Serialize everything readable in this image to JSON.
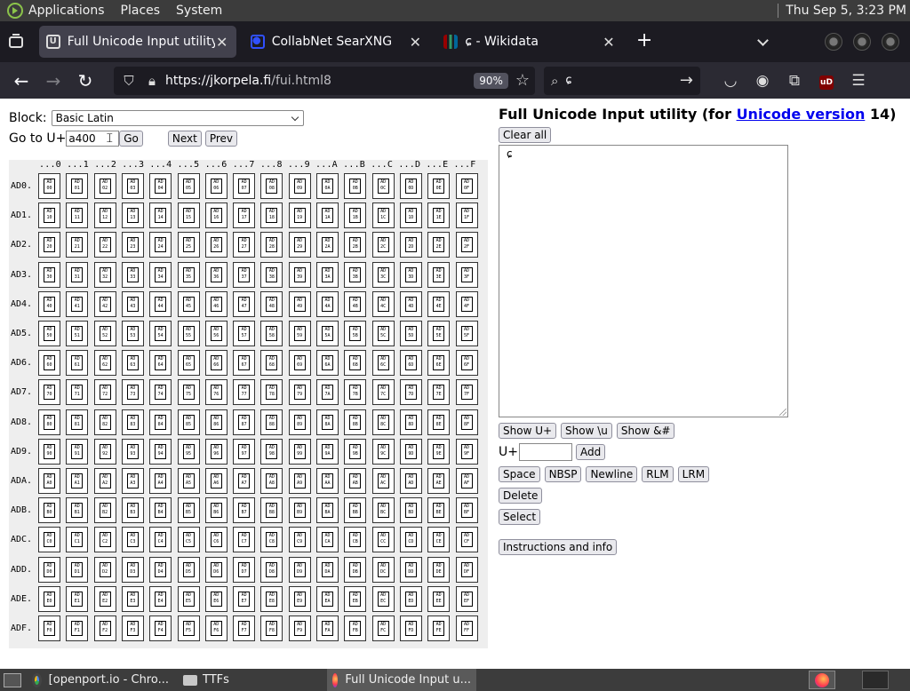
{
  "system_panel": {
    "menus": [
      "Applications",
      "Places",
      "System"
    ],
    "clock": "Thu Sep  5,  3:23 PM"
  },
  "tabs": [
    {
      "title": "Full Unicode Input utility",
      "active": true,
      "icon": "unicode-favicon"
    },
    {
      "title": "CollabNet SearXNG",
      "active": false,
      "icon": "searxng-favicon"
    },
    {
      "title": "ɕ - Wikidata",
      "active": false,
      "icon": "wikidata-favicon"
    }
  ],
  "navbar": {
    "url_host": "https://jkorpela.fi",
    "url_path": "/fui.html8",
    "zoom": "90%",
    "search_query": "ɕ"
  },
  "page": {
    "block_label": "Block:",
    "block_value": "Basic Latin",
    "goto_label": "Go to U+",
    "goto_value": "a400",
    "go_button": "Go",
    "next_button": "Next",
    "prev_button": "Prev",
    "col_header": "...0 ...1 ...2 ...3 ...4 ...5 ...6 ...7 ...8 ...9 ...A ...B ...C ...D ...E ...F",
    "rows": [
      "AD0.",
      "AD1.",
      "AD2.",
      "AD3.",
      "AD4.",
      "AD5.",
      "AD6.",
      "AD7.",
      "AD8.",
      "AD9.",
      "ADA.",
      "ADB.",
      "ADC.",
      "ADD.",
      "ADE.",
      "ADF."
    ],
    "title_prefix": "Full Unicode Input utility (for ",
    "title_link": "Unicode version",
    "title_suffix": " 14)",
    "clear_all": "Clear all",
    "textarea_value": "ɕ",
    "show_uplus": "Show U+",
    "show_u": "Show \\u",
    "show_amp": "Show &#",
    "uplus_label": "U+",
    "add_button": "Add",
    "space_button": "Space",
    "nbsp_button": "NBSP",
    "newline_button": "Newline",
    "rlm_button": "RLM",
    "lrm_button": "LRM",
    "delete_button": "Delete",
    "select_button": "Select",
    "instructions_button": "Instructions and info"
  },
  "taskbar": {
    "items": [
      {
        "label": "[openport.io - Chro...",
        "icon": "chrome-icon"
      },
      {
        "label": "TTFs",
        "icon": "folder-icon"
      },
      {
        "label": "Full Unicode Input u...",
        "icon": "firefox-icon"
      }
    ]
  }
}
